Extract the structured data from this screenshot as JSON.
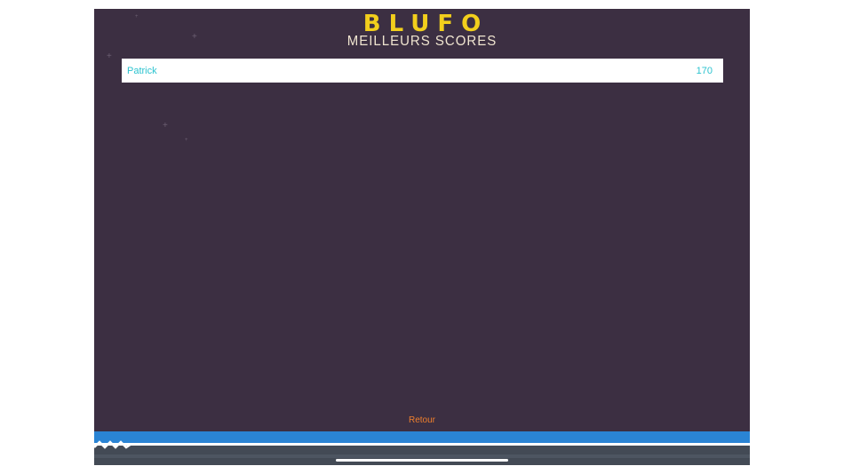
{
  "header": {
    "title": "BLUFO",
    "subtitle": "MEILLEURS SCORES"
  },
  "scores": [
    {
      "name": "Patrick",
      "score": "170"
    }
  ],
  "footer": {
    "back_label": "Retour"
  },
  "colors": {
    "background": "#3c2f42",
    "title": "#f2cf1c",
    "subtitle": "#efe4cf",
    "score_text": "#2cc3cf",
    "back_button": "#ef7f2d",
    "ground": "#2a84d4"
  }
}
